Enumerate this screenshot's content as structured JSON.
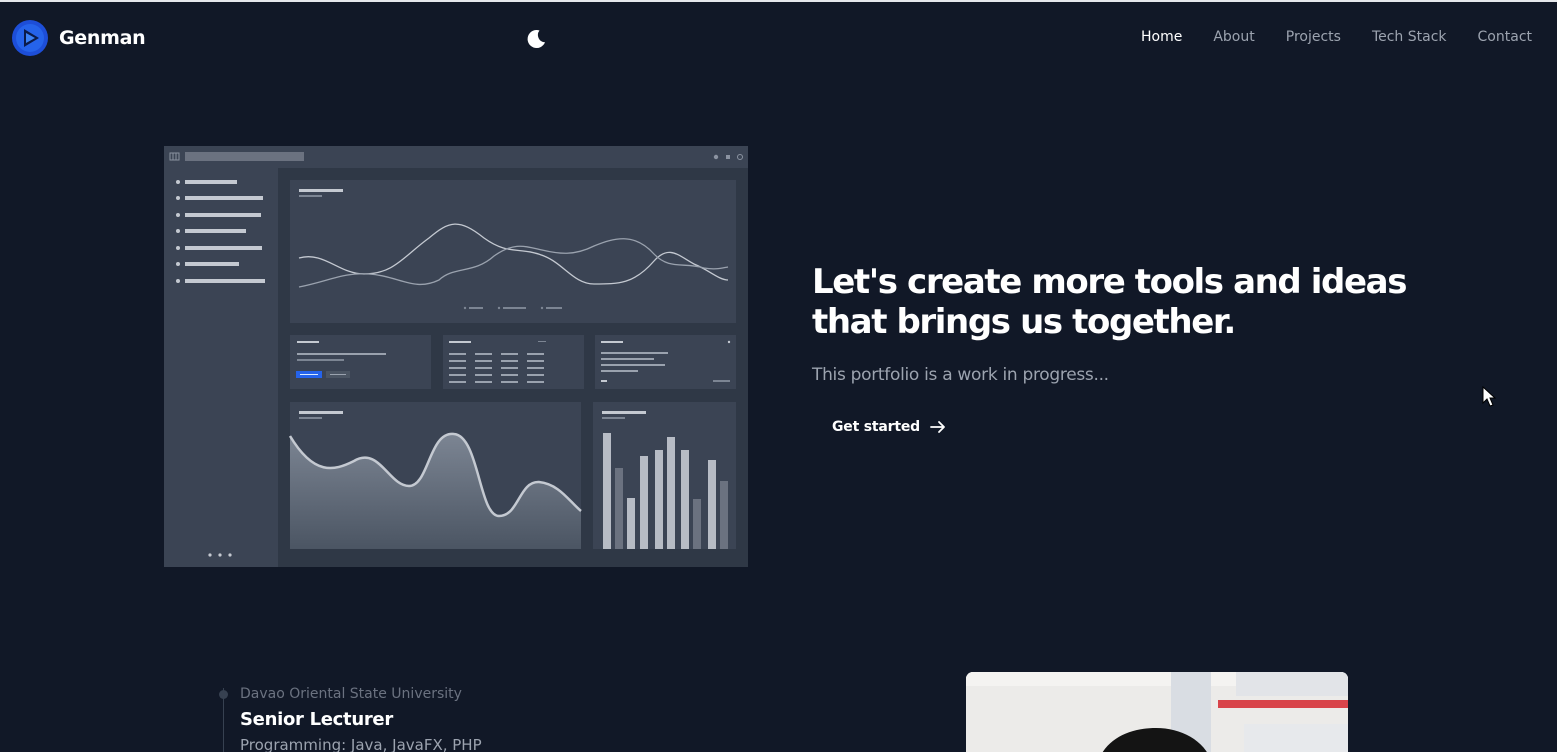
{
  "nav": {
    "brand": "Genman",
    "links": [
      {
        "label": "Home",
        "active": true
      },
      {
        "label": "About",
        "active": false
      },
      {
        "label": "Projects",
        "active": false
      },
      {
        "label": "Tech Stack",
        "active": false
      },
      {
        "label": "Contact",
        "active": false
      }
    ],
    "theme_toggle_icon": "moon-icon"
  },
  "hero": {
    "title_line1": "Let's create more tools and ideas",
    "title_line2": "that brings us together.",
    "subtitle": "This portfolio is a work in progress...",
    "cta_label": "Get started",
    "cta_icon": "arrow-right-icon",
    "illustration": "dashboard-illustration"
  },
  "experience": {
    "organization": "Davao Oriental State University",
    "role": "Senior Lecturer",
    "description": "Programming: Java, JavaFX, PHP"
  },
  "colors": {
    "background": "#111827",
    "text_primary": "#ffffff",
    "text_muted": "#9ca3af",
    "logo_blue": "#2563eb",
    "illustration_panel": "#3b4454"
  }
}
